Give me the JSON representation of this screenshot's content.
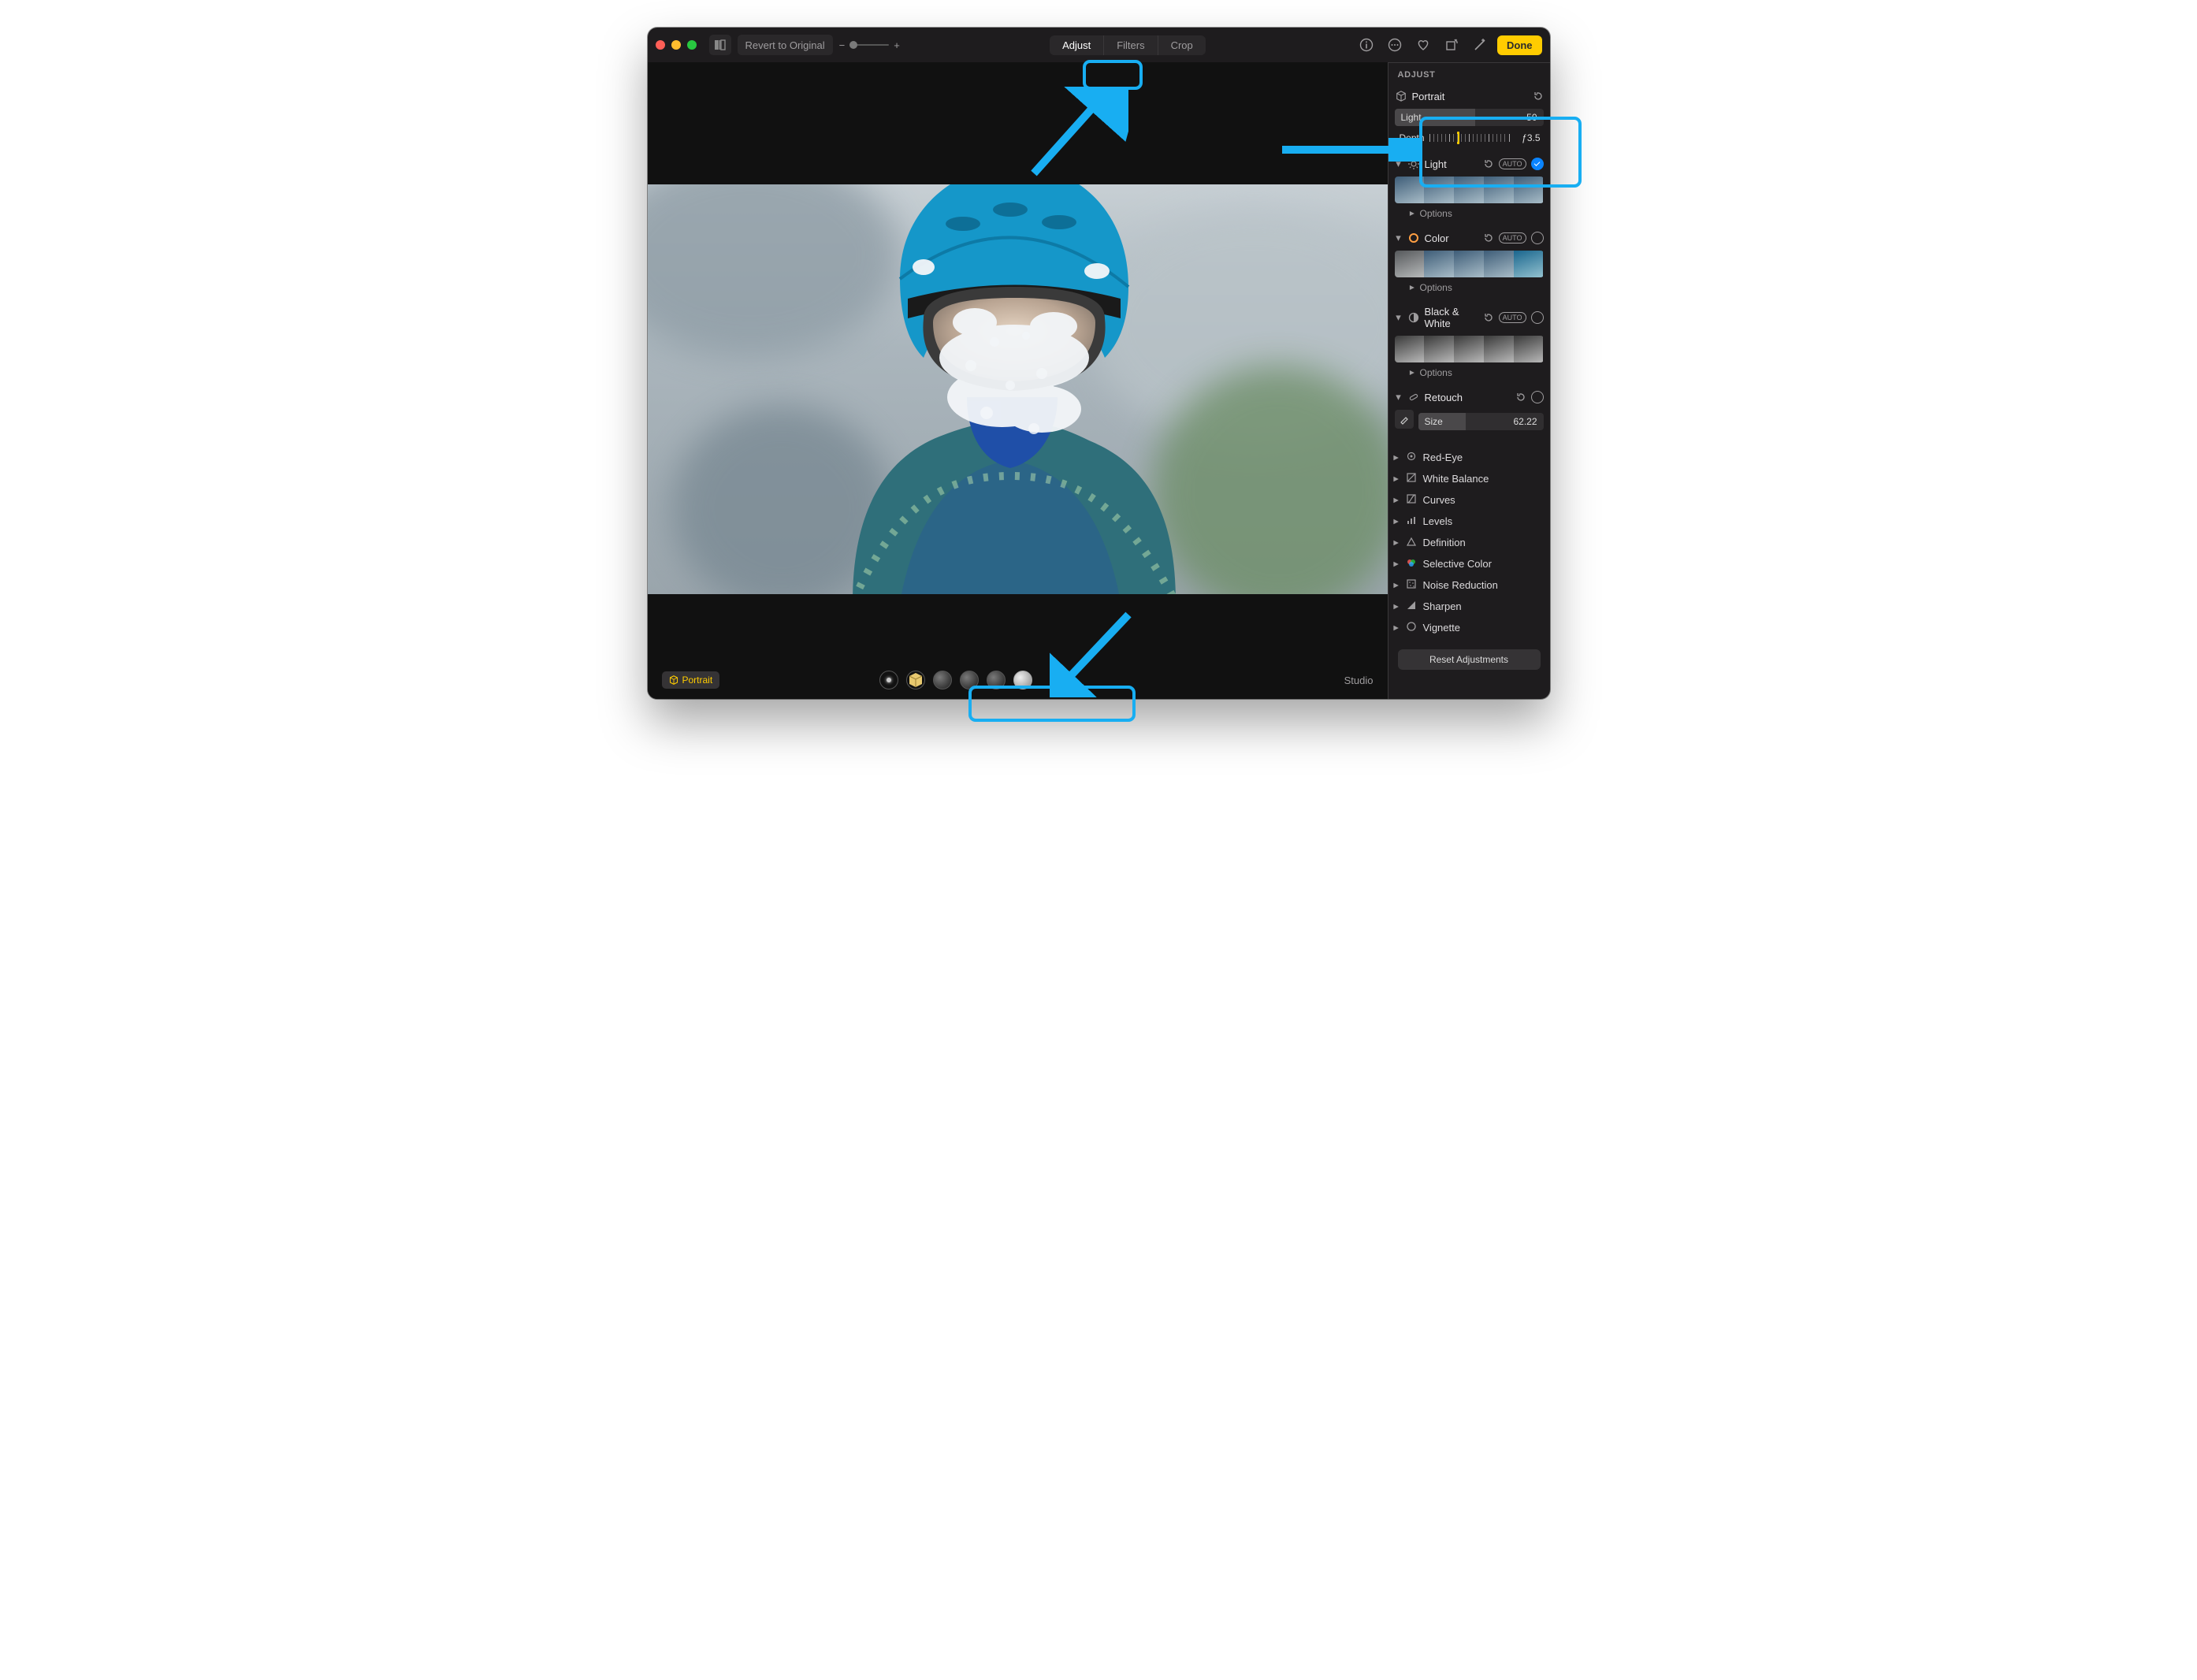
{
  "toolbar": {
    "revert_label": "Revert to Original",
    "tabs": [
      "Adjust",
      "Filters",
      "Crop"
    ],
    "active_tab": "Adjust",
    "done_label": "Done"
  },
  "canvas": {
    "badge_label": "Portrait",
    "lighting_label": "Studio",
    "lighting_options": [
      "Natural",
      "Studio",
      "Contour",
      "Stage",
      "Stage Mono",
      "High-Key Mono"
    ],
    "active_lighting_index": 1
  },
  "sidebar": {
    "panel_title": "ADJUST",
    "portrait": {
      "label": "Portrait",
      "light_label": "Light",
      "light_value": "50",
      "light_percent": 50,
      "depth_label": "Depth",
      "depth_value": "ƒ3.5",
      "depth_percent": 35
    },
    "light": {
      "label": "Light",
      "auto": "AUTO",
      "options": "Options",
      "enabled": true
    },
    "color": {
      "label": "Color",
      "auto": "AUTO",
      "options": "Options",
      "enabled": false
    },
    "bw": {
      "label": "Black & White",
      "auto": "AUTO",
      "options": "Options",
      "enabled": false
    },
    "retouch": {
      "label": "Retouch",
      "size_label": "Size",
      "size_value": "62.22",
      "size_percent": 33,
      "enabled": false
    },
    "collapsed": [
      {
        "label": "Red-Eye",
        "icon": "redeye-icon"
      },
      {
        "label": "White Balance",
        "icon": "whitebalance-icon"
      },
      {
        "label": "Curves",
        "icon": "curves-icon"
      },
      {
        "label": "Levels",
        "icon": "levels-icon"
      },
      {
        "label": "Definition",
        "icon": "definition-icon"
      },
      {
        "label": "Selective Color",
        "icon": "selectivecolor-icon"
      },
      {
        "label": "Noise Reduction",
        "icon": "noise-icon"
      },
      {
        "label": "Sharpen",
        "icon": "sharpen-icon"
      },
      {
        "label": "Vignette",
        "icon": "vignette-icon"
      }
    ],
    "reset_label": "Reset Adjustments"
  }
}
